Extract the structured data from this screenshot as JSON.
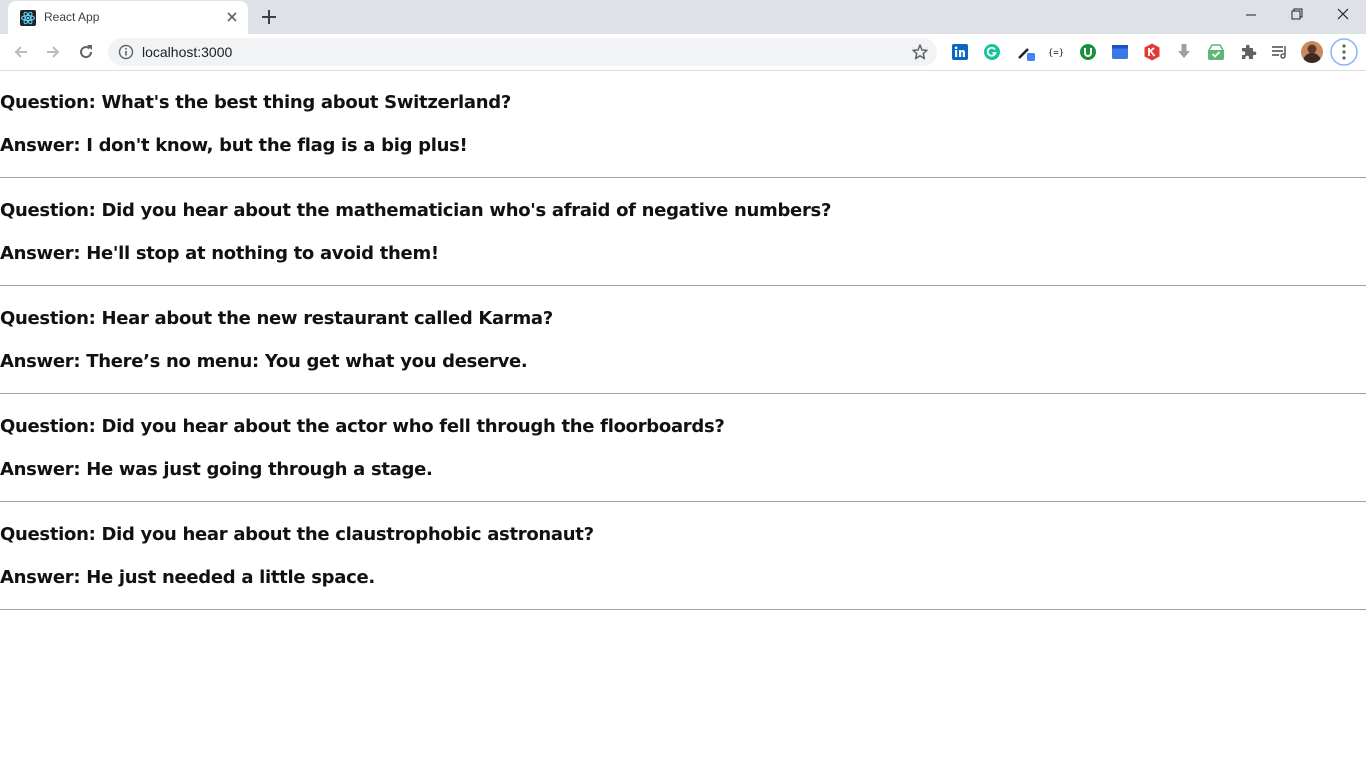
{
  "browser": {
    "tab_title": "React App",
    "url": "localhost:3000"
  },
  "jokes": [
    {
      "question": "Question: What's the best thing about Switzerland?",
      "answer": "Answer: I don't know, but the flag is a big plus!"
    },
    {
      "question": "Question: Did you hear about the mathematician who's afraid of negative numbers?",
      "answer": "Answer: He'll stop at nothing to avoid them!"
    },
    {
      "question": "Question: Hear about the new restaurant called Karma?",
      "answer": "Answer: There’s no menu: You get what you deserve."
    },
    {
      "question": "Question: Did you hear about the actor who fell through the floorboards?",
      "answer": "Answer: He was just going through a stage."
    },
    {
      "question": "Question: Did you hear about the claustrophobic astronaut?",
      "answer": "Answer: He just needed a little space."
    }
  ],
  "icons": [
    "react-icon",
    "close-icon",
    "plus-icon",
    "minimize-icon",
    "restore-icon",
    "window-close-icon",
    "back-icon",
    "forward-icon",
    "reload-icon",
    "info-icon",
    "star-icon",
    "linkedin-icon",
    "grammarly-icon",
    "eyedropper-icon",
    "json-icon",
    "extension-green-icon",
    "extension-blue-icon",
    "extension-red-icon",
    "download-icon",
    "extension-check-icon",
    "puzzle-icon",
    "reading-list-icon",
    "avatar",
    "menu-icon"
  ]
}
